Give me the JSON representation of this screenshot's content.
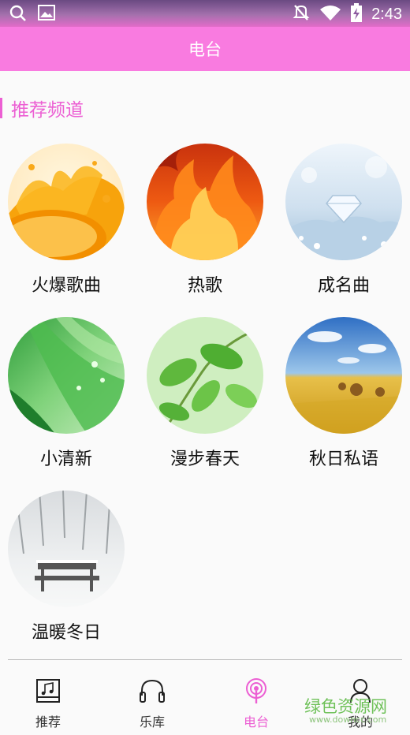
{
  "status_bar": {
    "time": "2:43",
    "left_icons": [
      "search-icon",
      "image-icon"
    ],
    "right_icons": [
      "mute-icon",
      "wifi-icon",
      "battery-charging-icon"
    ]
  },
  "app_bar": {
    "title": "电台"
  },
  "section": {
    "title": "推荐频道"
  },
  "channels": [
    {
      "label": "火爆歌曲",
      "image": "orange-juice-splash"
    },
    {
      "label": "热歌",
      "image": "fire-flames"
    },
    {
      "label": "成名曲",
      "image": "diamond-on-ice"
    },
    {
      "label": "小清新",
      "image": "green-leaf-droplets"
    },
    {
      "label": "漫步春天",
      "image": "spring-leaves"
    },
    {
      "label": "秋日私语",
      "image": "autumn-hay-field"
    },
    {
      "label": "温暖冬日",
      "image": "snowy-bench"
    }
  ],
  "tabs": [
    {
      "label": "推荐",
      "icon": "music-note-icon",
      "active": false
    },
    {
      "label": "乐库",
      "icon": "headphones-icon",
      "active": false
    },
    {
      "label": "电台",
      "icon": "radio-icon",
      "active": true
    },
    {
      "label": "我的",
      "icon": "user-icon",
      "active": false
    }
  ],
  "watermark": {
    "text": "绿色资源网",
    "url": "www.downcc.com"
  },
  "colors": {
    "accent": "#ec5fd3",
    "app_bar": "#f97be0",
    "background": "#fafafa"
  }
}
